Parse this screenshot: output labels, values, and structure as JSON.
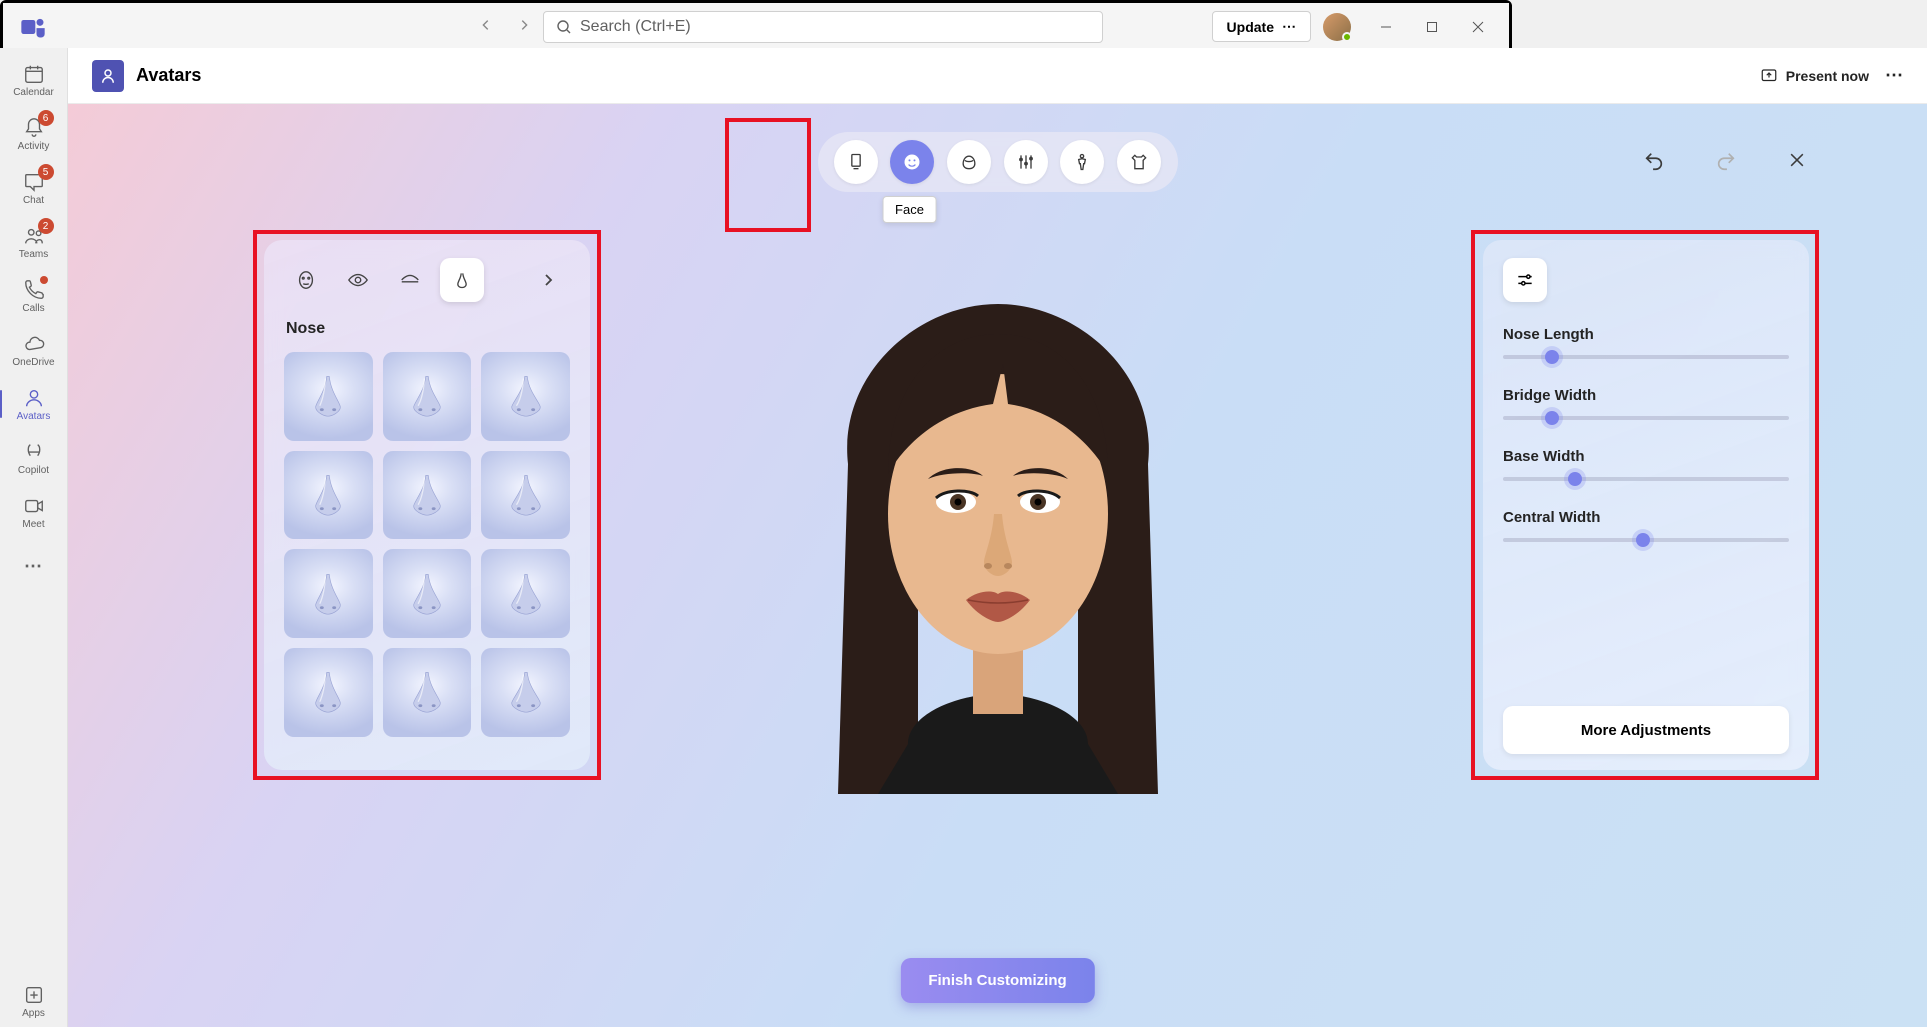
{
  "titlebar": {
    "search_placeholder": "Search (Ctrl+E)",
    "update_label": "Update"
  },
  "rail": {
    "items": [
      {
        "name": "calendar",
        "label": "Calendar",
        "badge": ""
      },
      {
        "name": "activity",
        "label": "Activity",
        "badge": "6"
      },
      {
        "name": "chat",
        "label": "Chat",
        "badge": "5"
      },
      {
        "name": "teams",
        "label": "Teams",
        "badge": "2"
      },
      {
        "name": "calls",
        "label": "Calls",
        "badge": "dot"
      },
      {
        "name": "onedrive",
        "label": "OneDrive",
        "badge": ""
      },
      {
        "name": "avatars",
        "label": "Avatars",
        "badge": "",
        "selected": true
      },
      {
        "name": "copilot",
        "label": "Copilot",
        "badge": ""
      },
      {
        "name": "meet",
        "label": "Meet",
        "badge": ""
      }
    ],
    "apps_label": "Apps"
  },
  "header": {
    "title": "Avatars",
    "present_label": "Present now"
  },
  "categories": {
    "items": [
      "Templates",
      "Face",
      "Hair",
      "Appearance",
      "Body",
      "Wardrobe"
    ],
    "active_index": 1,
    "tooltip": "Face"
  },
  "left_panel": {
    "sub_tabs": [
      "face-shape",
      "eyes",
      "eyebrows",
      "nose"
    ],
    "active_sub_tab_index": 3,
    "title": "Nose",
    "option_count": 12
  },
  "right_panel": {
    "sliders": [
      {
        "label": "Nose Length",
        "value": 17
      },
      {
        "label": "Bridge Width",
        "value": 17
      },
      {
        "label": "Base Width",
        "value": 25
      },
      {
        "label": "Central Width",
        "value": 49
      }
    ],
    "more_label": "More Adjustments"
  },
  "finish_label": "Finish Customizing"
}
